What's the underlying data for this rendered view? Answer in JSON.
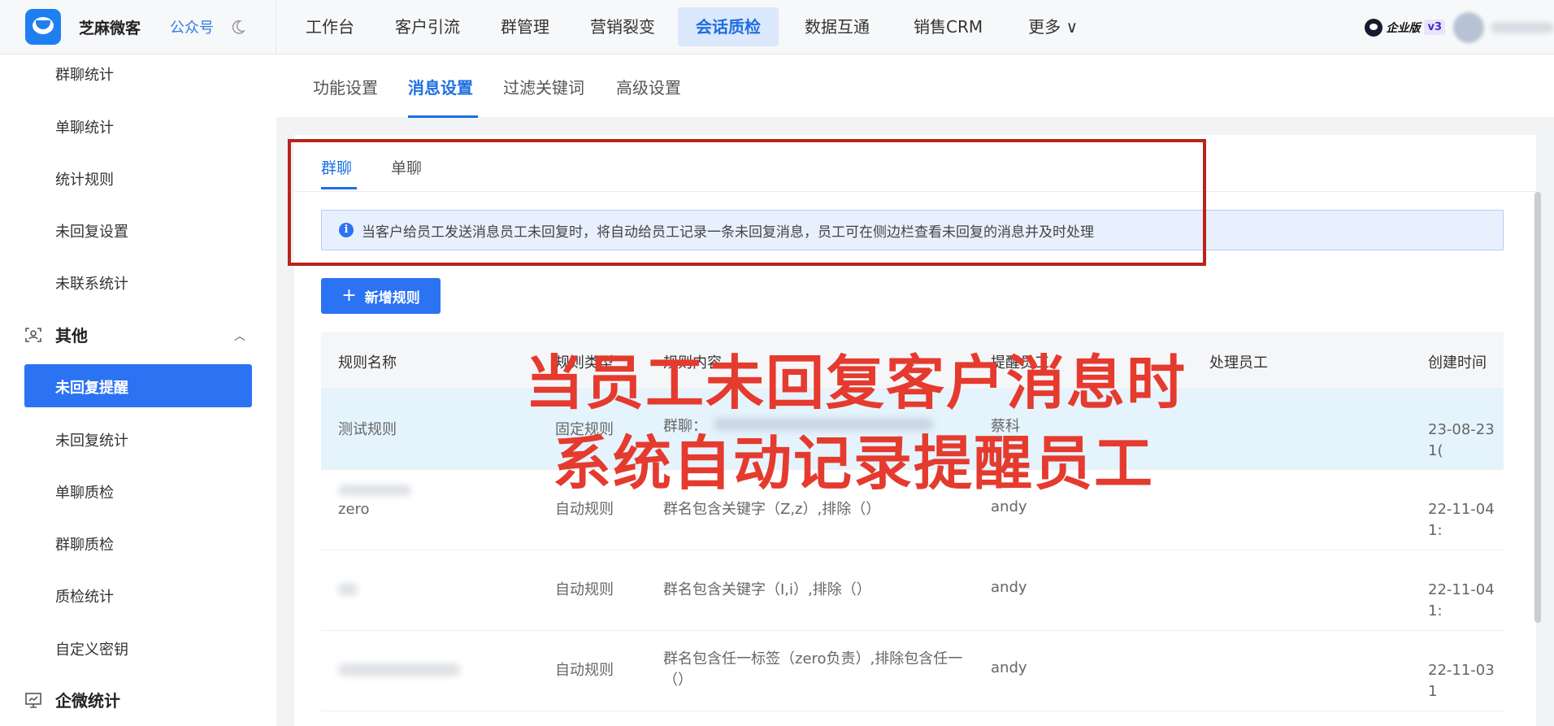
{
  "brand": {
    "name": "芝麻微客",
    "gzh": "公众号"
  },
  "nav": [
    {
      "label": "工作台"
    },
    {
      "label": "客户引流"
    },
    {
      "label": "群管理"
    },
    {
      "label": "营销裂变"
    },
    {
      "label": "会话质检",
      "active": true
    },
    {
      "label": "数据互通"
    },
    {
      "label": "销售CRM"
    },
    {
      "label": "更多 ∨"
    }
  ],
  "account": {
    "edition": "企业版",
    "version": "v3"
  },
  "sidebar": {
    "items_top": [
      "群聊统计",
      "单聊统计",
      "统计规则",
      "未回复设置",
      "未联系统计"
    ],
    "group_other": "其他",
    "items_other": [
      "未回复提醒",
      "未回复统计",
      "单聊质检",
      "群聊质检",
      "质检统计",
      "自定义密钥"
    ],
    "group_qw": "企微统计"
  },
  "tabs": [
    "功能设置",
    "消息设置",
    "过滤关键词",
    "高级设置"
  ],
  "subtabs": [
    "群聊",
    "单聊"
  ],
  "notice": "当客户给员工发送消息员工未回复时，将自动给员工记录一条未回复消息，员工可在侧边栏查看未回复的消息并及时处理",
  "add_button": "新增规则",
  "table": {
    "headers": [
      "规则名称",
      "规则类型",
      "规则内容",
      "提醒员工",
      "处理员工",
      "创建时间"
    ],
    "rows": [
      {
        "name": "测试规则",
        "type": "固定规则",
        "content": "群聊：",
        "staff": "蔡科",
        "time": "23-08-23 1("
      },
      {
        "name": "zero",
        "type": "自动规则",
        "content": "群名包含关键字（Z,z）,排除（）",
        "staff": "andy",
        "time": "22-11-04 1:"
      },
      {
        "name": "",
        "type": "自动规则",
        "content": "群名包含关键字（I,i）,排除（）",
        "staff": "andy",
        "time": "22-11-04 1:"
      },
      {
        "name": "",
        "type": "自动规则",
        "content": "群名包含任一标签（zero负责）,排除包含任一（）",
        "staff": "andy",
        "time": "22-11-03 1"
      }
    ]
  },
  "overlay": {
    "line1": "当员工未回复客户消息时",
    "line2": "系统自动记录提醒员工"
  },
  "colors": {
    "primary": "#2b73f3",
    "annotation": "#e53a2e"
  }
}
